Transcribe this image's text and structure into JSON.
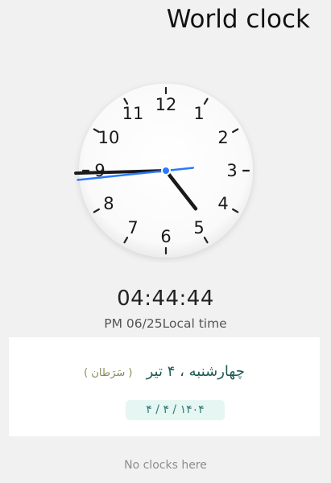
{
  "header": {
    "title": "World clock"
  },
  "clock": {
    "numerals": [
      "12",
      "1",
      "2",
      "3",
      "4",
      "5",
      "6",
      "7",
      "8",
      "9",
      "10",
      "11"
    ],
    "time": {
      "hours": 4,
      "minutes": 44,
      "seconds": 44
    },
    "second_hand_color": "#2979ff",
    "hand_color": "#1a1a1a"
  },
  "local_time": {
    "digits": "04:44:44",
    "caption": "PM 06/25Local time"
  },
  "persian_card": {
    "weekday_date": "چهارشنبه ، ۴ تیر",
    "zodiac": "( سَرَطان )",
    "solar_date": "۱۴۰۴ / ۴ / ۴"
  },
  "empty_state": "No clocks here"
}
